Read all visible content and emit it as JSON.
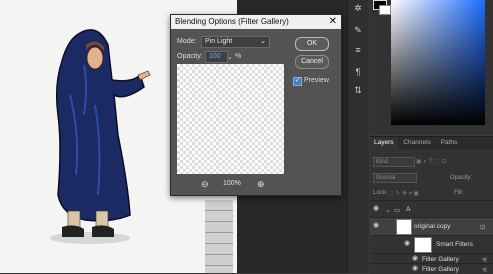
{
  "dialog": {
    "title": "Blending Options (Filter Gallery)",
    "close_glyph": "✕",
    "mode_label": "Mode:",
    "mode_value": "Pin Light",
    "opacity_label": "Opacity:",
    "opacity_value": "100",
    "opacity_unit": "%",
    "ok_label": "OK",
    "cancel_label": "Cancel",
    "preview_label": "Preview",
    "preview_checked": true,
    "zoom_out_glyph": "⊖",
    "zoom_value": "100%",
    "zoom_in_glyph": "⊕"
  },
  "toolstrip": {
    "icons": [
      "rotate-icon",
      "brush-settings-icon",
      "sliders-icon",
      "paragraph-icon",
      "adjust-icon"
    ]
  },
  "layers_panel": {
    "tabs": [
      "Layers",
      "Channels",
      "Paths"
    ],
    "kind_placeholder": "Kind",
    "blend_value": "Normal",
    "opacity_label": "Opacity:",
    "lock_label": "Lock:",
    "fill_label": "Fill:",
    "group_name": "A",
    "layer_name": "original copy",
    "smart_filters_label": "Smart Filters",
    "filter_items": [
      "Filter Gallery",
      "Filter Gallery"
    ]
  },
  "colors": {
    "accent": "#3d7fe0",
    "hue": "#1e6cff"
  }
}
